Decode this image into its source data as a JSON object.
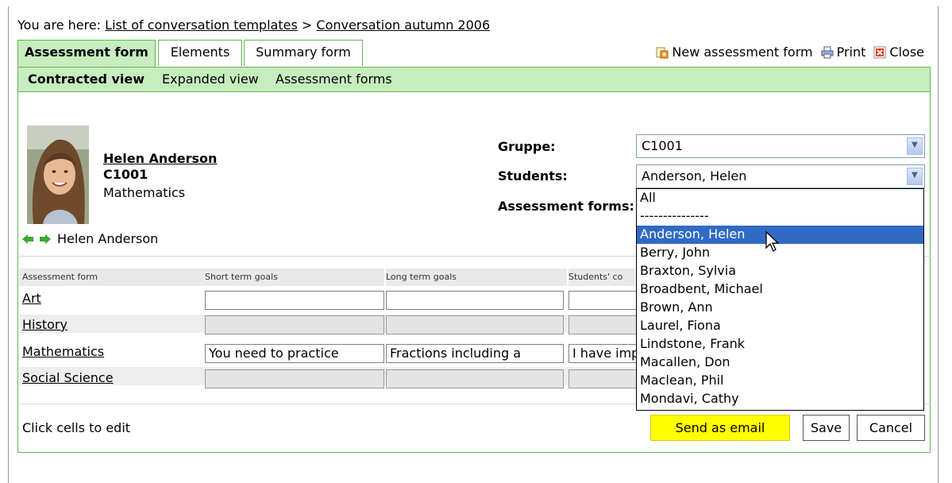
{
  "breadcrumb": {
    "prefix": "You are here:",
    "link1": "List of conversation templates",
    "separator": ">",
    "link2": "Conversation autumn 2006"
  },
  "tabs": [
    {
      "label": "Assessment form",
      "active": true
    },
    {
      "label": "Elements",
      "active": false
    },
    {
      "label": "Summary form",
      "active": false
    }
  ],
  "top_actions": {
    "new_form": "New assessment form",
    "print": "Print",
    "close": "Close"
  },
  "subnav": {
    "contracted": "Contracted view",
    "expanded": "Expanded view",
    "forms": "Assessment forms"
  },
  "student": {
    "name": "Helen Anderson",
    "group": "C1001",
    "subject": "Mathematics",
    "nav_label": "Helen Anderson"
  },
  "filters": {
    "group_label": "Gruppe:",
    "group_value": "C1001",
    "students_label": "Students:",
    "students_value": "Anderson, Helen",
    "forms_label": "Assessment forms:"
  },
  "dropdown": {
    "items": [
      "All",
      "---------------",
      "Anderson, Helen",
      "Berry, John",
      "Braxton, Sylvia",
      "Broadbent, Michael",
      "Brown, Ann",
      "Laurel, Fiona",
      "Lindstone, Frank",
      "Macallen, Don",
      "Maclean, Phil",
      "Mondavi, Cathy"
    ],
    "selected_index": 2
  },
  "table": {
    "headers": [
      "Assessment form",
      "Short term goals",
      "Long term goals",
      "Students' co"
    ],
    "rows": [
      {
        "label": "Art",
        "cells": [
          "",
          "",
          ""
        ]
      },
      {
        "label": "History",
        "cells": [
          "",
          "",
          ""
        ]
      },
      {
        "label": "Mathematics",
        "cells": [
          "You need to practice",
          "Fractions including a",
          "I have imp"
        ]
      },
      {
        "label": "Social Science",
        "cells": [
          "",
          "",
          ""
        ]
      }
    ]
  },
  "footer": {
    "hint": "Click cells to edit",
    "send_email": "Send as email",
    "save": "Save",
    "cancel": "Cancel"
  },
  "colors": {
    "tab_green": "#c6edbe",
    "border_green": "#67b35a",
    "selection_blue": "#316ac5",
    "email_button": "#ffff00"
  }
}
